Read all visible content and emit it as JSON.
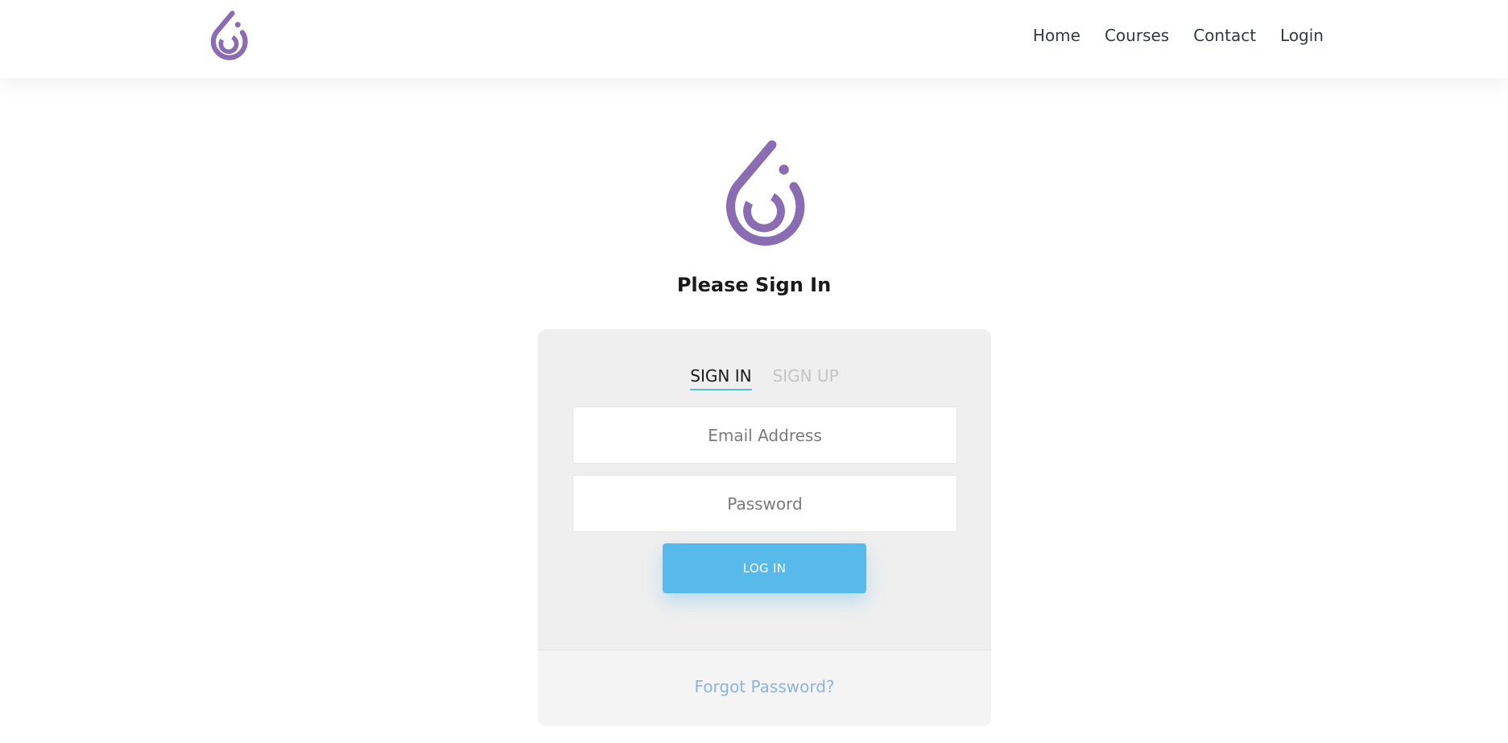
{
  "brand": {
    "logo_icon": "purple-swirl-drop-logo",
    "color": "#8a6cb3"
  },
  "nav": {
    "items": [
      {
        "label": "Home"
      },
      {
        "label": "Courses"
      },
      {
        "label": "Contact"
      },
      {
        "label": "Login"
      }
    ]
  },
  "main": {
    "title": "Please Sign In"
  },
  "auth_card": {
    "tabs": [
      {
        "label": "SIGN IN",
        "active": true
      },
      {
        "label": "SIGN UP",
        "active": false
      }
    ],
    "email": {
      "placeholder": "Email Address",
      "value": ""
    },
    "password": {
      "placeholder": "Password",
      "value": ""
    },
    "submit_label": "LOG IN",
    "accent_color": "#58b9eb",
    "forgot_label": "Forgot Password?"
  }
}
